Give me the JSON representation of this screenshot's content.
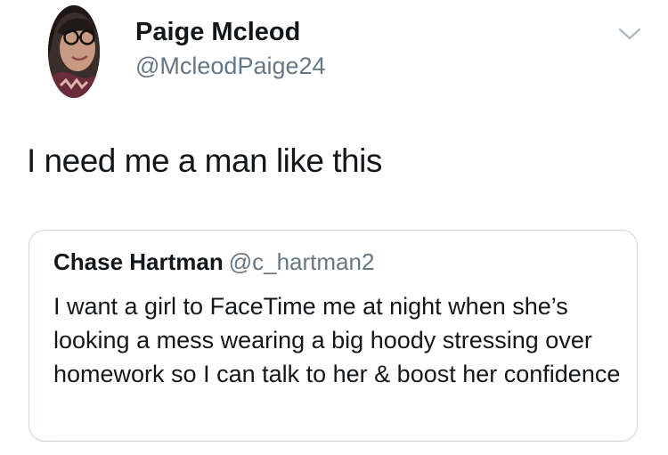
{
  "tweet": {
    "author_name": "Paige Mcleod",
    "author_handle": "@McleodPaige24",
    "text": "I need me a man like this"
  },
  "quoted_tweet": {
    "author_name": "Chase Hartman",
    "author_handle": "@c_hartman2",
    "text": "I want a girl to FaceTime me at night when she’s looking a mess wearing a big hoody stressing over homework so I can talk to her & boost her confidence"
  },
  "icons": {
    "menu": "chevron-down-icon",
    "avatar": "profile-photo"
  },
  "colors": {
    "text_primary": "#14171a",
    "text_secondary": "#657786",
    "card_border": "#ccd6dd",
    "background": "#ffffff"
  }
}
